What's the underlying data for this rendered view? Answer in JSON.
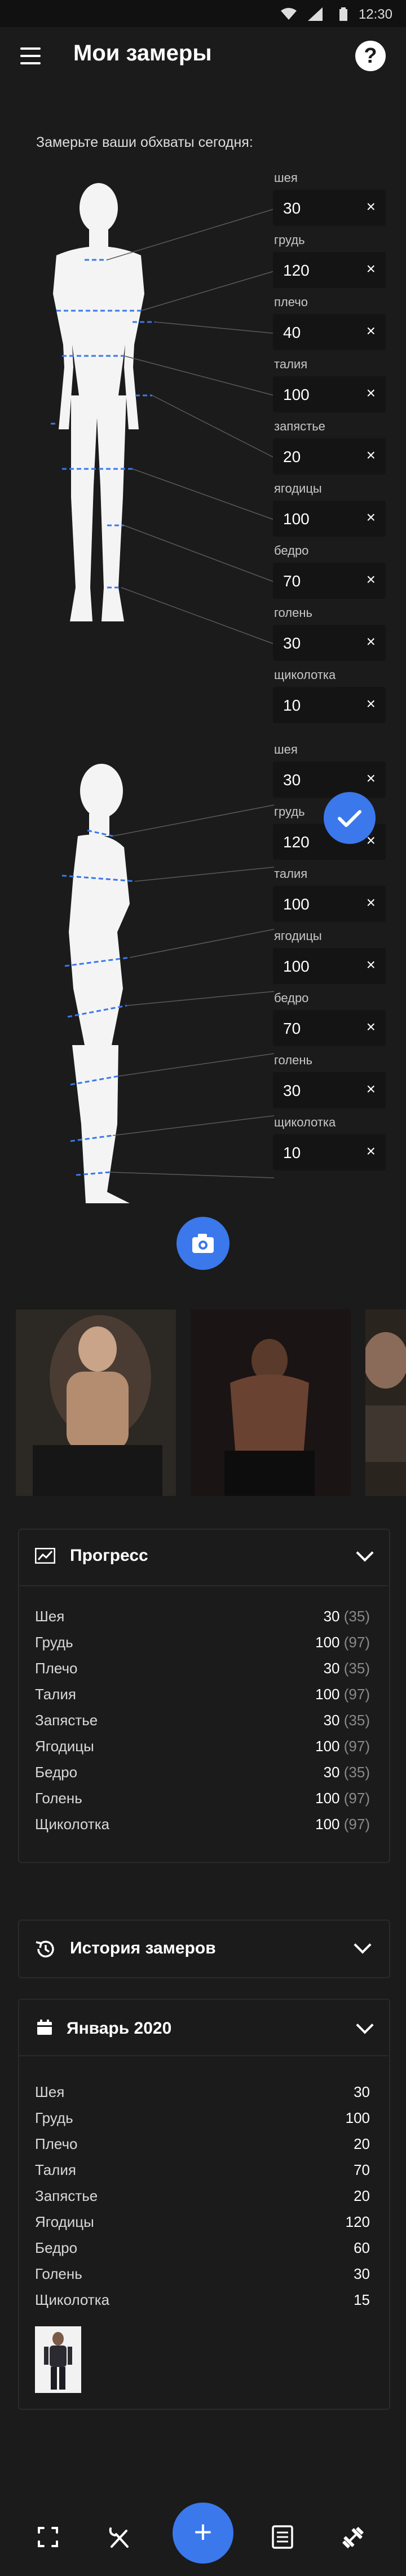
{
  "status": {
    "time": "12:30"
  },
  "header": {
    "title": "Мои замеры",
    "help": "?"
  },
  "measure": {
    "prompt": "Замерьте ваши обхваты сегодня:",
    "front": [
      {
        "label": "шея",
        "value": "30"
      },
      {
        "label": "грудь",
        "value": "120"
      },
      {
        "label": "плечо",
        "value": "40"
      },
      {
        "label": "талия",
        "value": "100"
      },
      {
        "label": "запястье",
        "value": "20"
      },
      {
        "label": "ягодицы",
        "value": "100"
      },
      {
        "label": "бедро",
        "value": "70"
      },
      {
        "label": "голень",
        "value": "30"
      },
      {
        "label": "щиколотка",
        "value": "10"
      }
    ],
    "side": [
      {
        "label": "шея",
        "value": "30"
      },
      {
        "label": "грудь",
        "value": "120"
      },
      {
        "label": "талия",
        "value": "100"
      },
      {
        "label": "ягодицы",
        "value": "100"
      },
      {
        "label": "бедро",
        "value": "70"
      },
      {
        "label": "голень",
        "value": "30"
      },
      {
        "label": "щиколотка",
        "value": "10"
      }
    ],
    "clear": "×"
  },
  "progress": {
    "title": "Прогресс",
    "rows": [
      {
        "label": "Шея",
        "value": "30",
        "prev": "(35)"
      },
      {
        "label": "Грудь",
        "value": "100",
        "prev": "(97)"
      },
      {
        "label": "Плечо",
        "value": "30",
        "prev": "(35)"
      },
      {
        "label": "Талия",
        "value": "100",
        "prev": "(97)"
      },
      {
        "label": "Запястье",
        "value": "30",
        "prev": "(35)"
      },
      {
        "label": "Ягодицы",
        "value": "100",
        "prev": "(97)"
      },
      {
        "label": "Бедро",
        "value": "30",
        "prev": "(35)"
      },
      {
        "label": "Голень",
        "value": "100",
        "prev": "(97)"
      },
      {
        "label": "Щиколотка",
        "value": "100",
        "prev": "(97)"
      }
    ]
  },
  "history": {
    "title": "История замеров"
  },
  "month": {
    "title": "Январь 2020",
    "rows": [
      {
        "label": "Шея",
        "value": "30"
      },
      {
        "label": "Грудь",
        "value": "100"
      },
      {
        "label": "Плечо",
        "value": "20"
      },
      {
        "label": "Талия",
        "value": "70"
      },
      {
        "label": "Запястье",
        "value": "20"
      },
      {
        "label": "Ягодицы",
        "value": "120"
      },
      {
        "label": "Бедро",
        "value": "60"
      },
      {
        "label": "Голень",
        "value": "30"
      },
      {
        "label": "Щиколотка",
        "value": "15"
      }
    ]
  },
  "nav": {
    "add": "+"
  },
  "colors": {
    "accent": "#3a78ec",
    "background": "#1b1b1b"
  }
}
